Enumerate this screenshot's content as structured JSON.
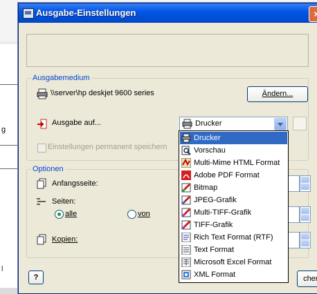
{
  "window": {
    "title": "Ausgabe-Einstellungen",
    "close_label": "×"
  },
  "background": {
    "chars": [
      "i",
      "g",
      "l"
    ]
  },
  "ausgabemedium": {
    "group_label": "Ausgabemedium",
    "printer_name": "\\\\server\\hp deskjet 9600 series",
    "change_button": "Ändern...",
    "output_label": "Ausgabe auf...",
    "output_selected": "Drucker",
    "save_checkbox_label": "Einstellungen permanent speichern"
  },
  "optionen": {
    "group_label": "Optionen",
    "start_page_label": "Anfangsseite:",
    "pages_label": "Seiten:",
    "radio_all": "alle",
    "radio_from": "von",
    "copies_label": "Kopien:"
  },
  "dropdown": {
    "items": [
      {
        "label": "Drucker",
        "icon": "printer-icon",
        "selected": true
      },
      {
        "label": "Vorschau",
        "icon": "magnifier-icon",
        "selected": false
      },
      {
        "label": "Multi-Mime HTML Format",
        "icon": "html-icon",
        "selected": false
      },
      {
        "label": "Adobe PDF Format",
        "icon": "pdf-icon",
        "selected": false
      },
      {
        "label": "Bitmap",
        "icon": "bitmap-icon",
        "selected": false
      },
      {
        "label": "JPEG-Grafik",
        "icon": "jpeg-icon",
        "selected": false
      },
      {
        "label": "Multi-TIFF-Grafik",
        "icon": "multi-tiff-icon",
        "selected": false
      },
      {
        "label": "TIFF-Grafik",
        "icon": "tiff-icon",
        "selected": false
      },
      {
        "label": "Rich Text Format (RTF)",
        "icon": "rtf-icon",
        "selected": false
      },
      {
        "label": "Text Format",
        "icon": "text-icon",
        "selected": false
      },
      {
        "label": "Microsoft Excel Format",
        "icon": "excel-icon",
        "selected": false
      },
      {
        "label": "XML Format",
        "icon": "xml-icon",
        "selected": false
      }
    ]
  },
  "footer": {
    "help_label": "?",
    "close_label_partial": "chen"
  },
  "colors": {
    "title_bar": "#0058e6",
    "group_label": "#0046d5",
    "selection": "#316ac5"
  }
}
